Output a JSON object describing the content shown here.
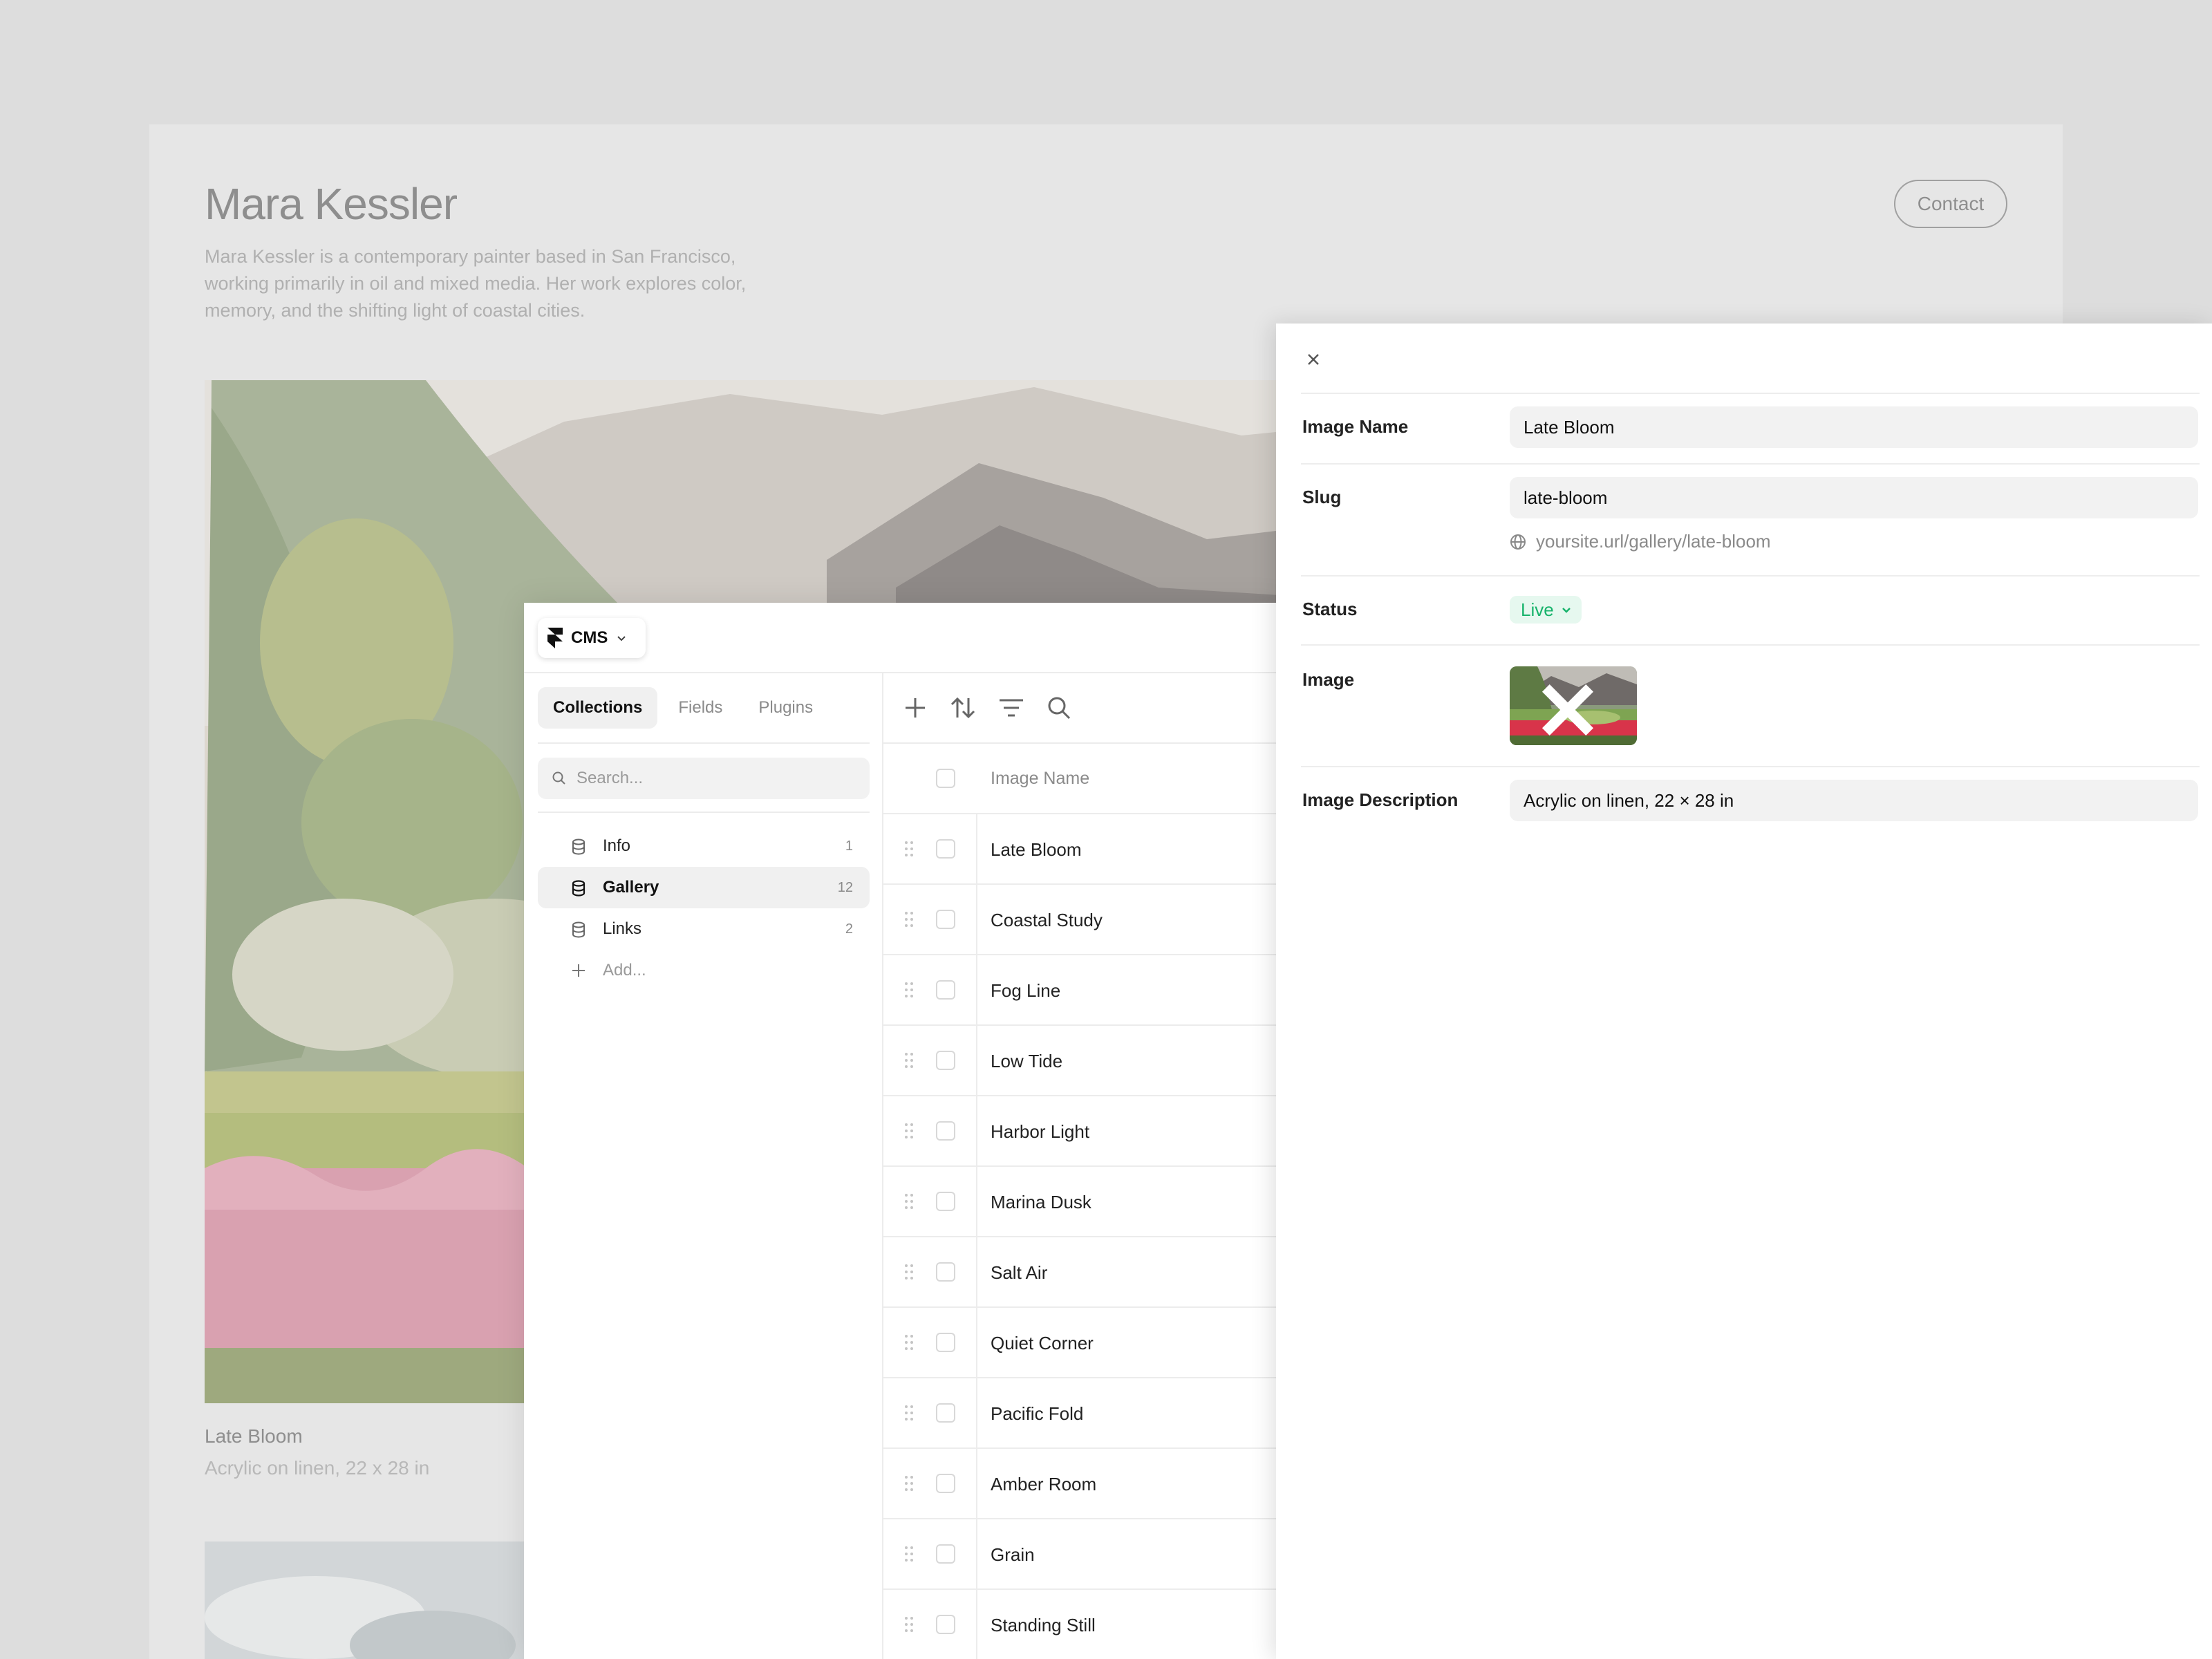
{
  "site": {
    "title": "Mara Kessler",
    "bio": "Mara Kessler is a contemporary painter based in San Francisco, working primarily in oil and mixed media. Her work explores color, memory, and the shifting light of coastal cities.",
    "contact_label": "Contact",
    "featured_caption_title": "Late Bloom",
    "featured_caption_sub": "Acrylic on linen, 22 x 28 in"
  },
  "cms": {
    "switcher_label": "CMS",
    "tabs": [
      {
        "label": "Collections"
      },
      {
        "label": "Fields"
      },
      {
        "label": "Plugins"
      }
    ],
    "search_placeholder": "Search...",
    "collections": [
      {
        "name": "Info",
        "count": "1"
      },
      {
        "name": "Gallery",
        "count": "12"
      },
      {
        "name": "Links",
        "count": "2"
      }
    ],
    "add_label": "Add...",
    "grid_header": "Image Name",
    "rows": [
      "Late Bloom",
      "Coastal Study",
      "Fog Line",
      "Low Tide",
      "Harbor Light",
      "Marina Dusk",
      "Salt Air",
      "Quiet Corner",
      "Pacific Fold",
      "Amber Room",
      "Grain",
      "Standing Still"
    ]
  },
  "panel": {
    "image_name_label": "Image Name",
    "image_name_value": "Late Bloom",
    "slug_label": "Slug",
    "slug_value": "late-bloom",
    "slug_url": "yoursite.url/gallery/late-bloom",
    "status_label": "Status",
    "status_value": "Live",
    "image_label": "Image",
    "description_label": "Image Description",
    "description_value": "Acrylic on linen, 22 × 28 in"
  },
  "colors": {
    "status_live": "#17b36b",
    "status_live_bg": "#e6f8ef"
  }
}
